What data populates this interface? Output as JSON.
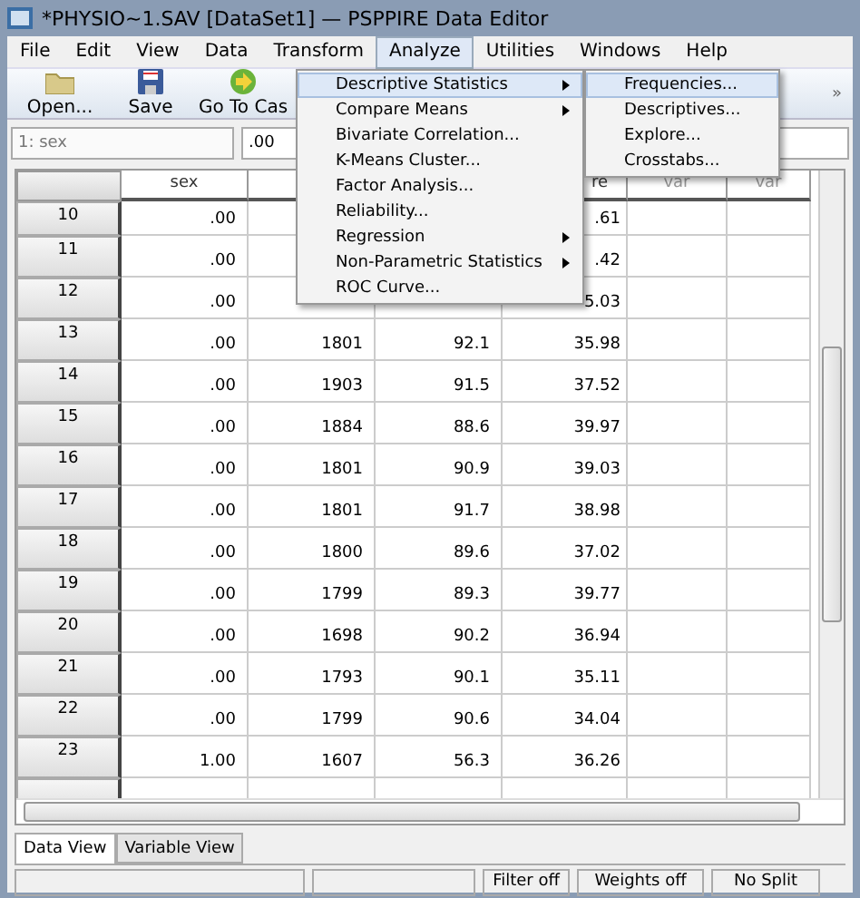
{
  "window": {
    "title": "*PHYSIO~1.SAV [DataSet1] — PSPPIRE Data Editor"
  },
  "menubar": [
    {
      "label": "File",
      "selected": false
    },
    {
      "label": "Edit",
      "selected": false
    },
    {
      "label": "View",
      "selected": false
    },
    {
      "label": "Data",
      "selected": false
    },
    {
      "label": "Transform",
      "selected": false
    },
    {
      "label": "Analyze",
      "selected": true
    },
    {
      "label": "Utilities",
      "selected": false
    },
    {
      "label": "Windows",
      "selected": false
    },
    {
      "label": "Help",
      "selected": false
    }
  ],
  "toolbar": {
    "buttons": [
      {
        "kind": "open",
        "label": "Open..."
      },
      {
        "kind": "save",
        "label": "Save"
      },
      {
        "kind": "goto",
        "label": "Go To Cas"
      }
    ],
    "overflow": "»"
  },
  "cell_ref": {
    "name": "1: sex",
    "value": ".00"
  },
  "table": {
    "columns": [
      "sex",
      null,
      null,
      "re",
      "var",
      "var"
    ],
    "rows": [
      {
        "num": "10",
        "cells": [
          ".00",
          null,
          null,
          ".61",
          null,
          null
        ]
      },
      {
        "num": "11",
        "cells": [
          ".00",
          null,
          null,
          ".42",
          null,
          null
        ]
      },
      {
        "num": "12",
        "cells": [
          ".00",
          null,
          null,
          "5.03",
          null,
          null
        ]
      },
      {
        "num": "13",
        "cells": [
          ".00",
          "1801",
          "92.1",
          "35.98",
          null,
          null
        ]
      },
      {
        "num": "14",
        "cells": [
          ".00",
          "1903",
          "91.5",
          "37.52",
          null,
          null
        ]
      },
      {
        "num": "15",
        "cells": [
          ".00",
          "1884",
          "88.6",
          "39.97",
          null,
          null
        ]
      },
      {
        "num": "16",
        "cells": [
          ".00",
          "1801",
          "90.9",
          "39.03",
          null,
          null
        ]
      },
      {
        "num": "17",
        "cells": [
          ".00",
          "1801",
          "91.7",
          "38.98",
          null,
          null
        ]
      },
      {
        "num": "18",
        "cells": [
          ".00",
          "1800",
          "89.6",
          "37.02",
          null,
          null
        ]
      },
      {
        "num": "19",
        "cells": [
          ".00",
          "1799",
          "89.3",
          "39.77",
          null,
          null
        ]
      },
      {
        "num": "20",
        "cells": [
          ".00",
          "1698",
          "90.2",
          "36.94",
          null,
          null
        ]
      },
      {
        "num": "21",
        "cells": [
          ".00",
          "1793",
          "90.1",
          "35.11",
          null,
          null
        ]
      },
      {
        "num": "22",
        "cells": [
          ".00",
          "1799",
          "90.6",
          "34.04",
          null,
          null
        ]
      },
      {
        "num": "23",
        "cells": [
          "1.00",
          "1607",
          "56.3",
          "36.26",
          null,
          null
        ]
      }
    ]
  },
  "menu": {
    "items": [
      {
        "label": "Descriptive Statistics",
        "submenu": true,
        "selected": true
      },
      {
        "label": "Compare Means",
        "submenu": true,
        "selected": false
      },
      {
        "label": "Bivariate Correlation...",
        "submenu": false,
        "selected": false
      },
      {
        "label": "K-Means Cluster...",
        "submenu": false,
        "selected": false
      },
      {
        "label": "Factor Analysis...",
        "submenu": false,
        "selected": false
      },
      {
        "label": "Reliability...",
        "submenu": false,
        "selected": false
      },
      {
        "label": "Regression",
        "submenu": true,
        "selected": false
      },
      {
        "label": "Non-Parametric Statistics",
        "submenu": true,
        "selected": false
      },
      {
        "label": "ROC Curve...",
        "submenu": false,
        "selected": false
      }
    ],
    "submenu": [
      {
        "label": "Frequencies...",
        "selected": true
      },
      {
        "label": "Descriptives...",
        "selected": false
      },
      {
        "label": "Explore...",
        "selected": false
      },
      {
        "label": "Crosstabs...",
        "selected": false
      }
    ]
  },
  "tabs": [
    {
      "label": "Data View",
      "selected": true
    },
    {
      "label": "Variable View",
      "selected": false
    }
  ],
  "status_bar": [
    "Filter off",
    "Weights off",
    "No Split"
  ]
}
